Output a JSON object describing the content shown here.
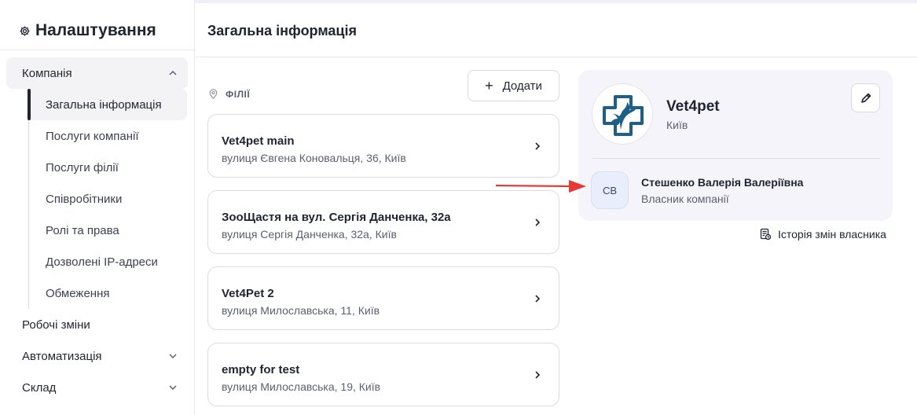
{
  "sidebar": {
    "title": "Налаштування",
    "company": "Компанія",
    "subitems": [
      "Загальна інформація",
      "Послуги компанії",
      "Послуги філії",
      "Співробітники",
      "Ролі та права",
      "Дозволені IP-адреси",
      "Обмеження"
    ],
    "items": [
      "Робочі зміни",
      "Автоматизація",
      "Склад"
    ]
  },
  "header": {
    "title": "Загальна інформація"
  },
  "branches": {
    "label": "ФІЛІЇ",
    "add_label": "Додати",
    "list": [
      {
        "name": "Vet4pet main",
        "address": "вулиця Євгена Коновальця, 36, Київ"
      },
      {
        "name": "ЗооЩастя на вул. Сергія Данченка, 32а",
        "address": "вулиця Сергія Данченка, 32а, Київ"
      },
      {
        "name": "Vet4Pet 2",
        "address": "вулиця Милославська, 11, Київ"
      },
      {
        "name": "empty for test",
        "address": "вулиця Милославська, 19, Київ"
      }
    ]
  },
  "company_card": {
    "name": "Vet4pet",
    "city": "Київ",
    "owner_initials": "СВ",
    "owner_name": "Стешенко Валерія Валеріївна",
    "owner_role": "Власник компанії",
    "history_label": "Історія змін власника"
  },
  "colors": {
    "accent": "#1e5f8a",
    "annotation_arrow": "#e53935"
  }
}
